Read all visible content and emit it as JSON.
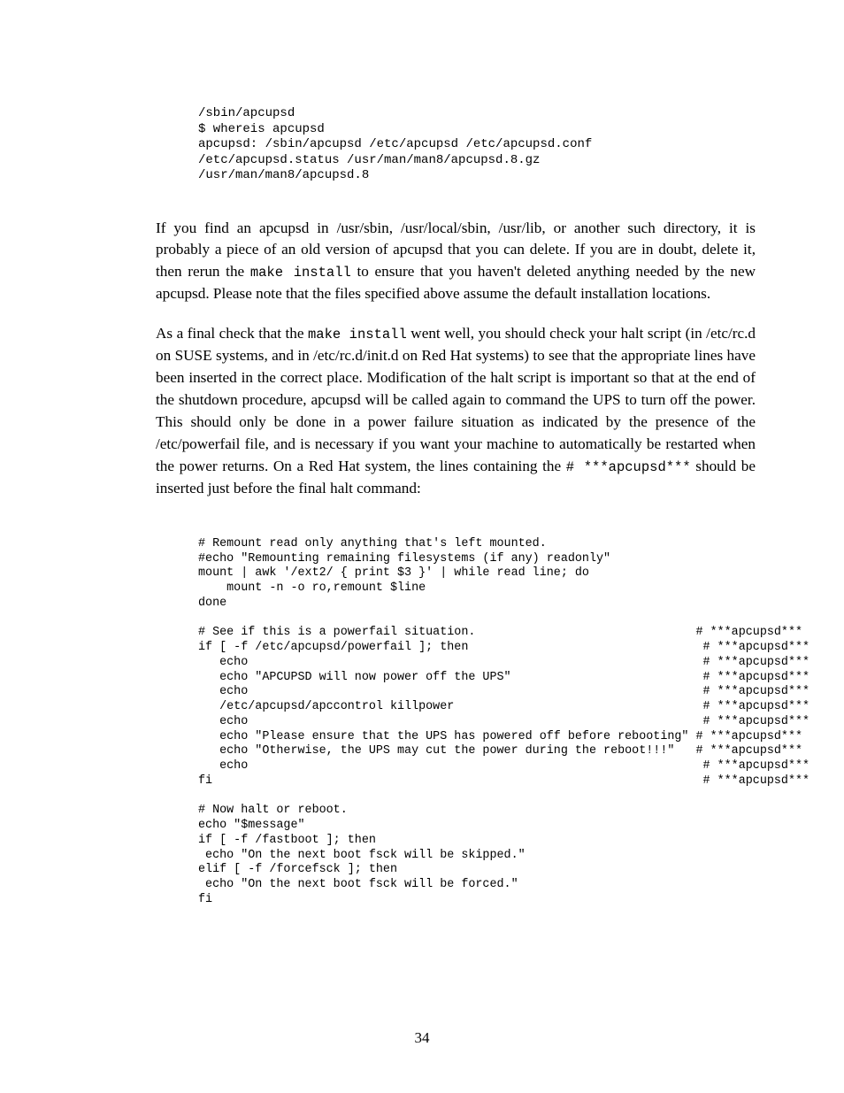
{
  "code1": "/sbin/apcupsd\n$ whereis apcupsd\napcupsd: /sbin/apcupsd /etc/apcupsd /etc/apcupsd.conf\n/etc/apcupsd.status /usr/man/man8/apcupsd.8.gz\n/usr/man/man8/apcupsd.8",
  "para1_a": "If you find an apcupsd in /usr/sbin, /usr/local/sbin, /usr/lib, or another such directory, it is probably a piece of an old version of apcupsd that you can delete. If you are in doubt, delete it, then rerun the ",
  "para1_code": "make install",
  "para1_b": " to ensure that you haven't deleted anything needed by the new apcupsd. Please note that the files specified above assume the default installation locations.",
  "para2_a": "As a final check that the ",
  "para2_code1": "make install",
  "para2_b": " went well, you should check your halt script (in /etc/rc.d on SUSE systems, and in /etc/rc.d/init.d on Red Hat systems) to see that the appropriate lines have been inserted in the correct place. Modification of the halt script is important so that at the end of the shutdown procedure, apcupsd will be called again to command the UPS to turn off the power. This should only be done in a power failure situation as indicated by the presence of the /etc/powerfail file, and is necessary if you want your machine to automatically be restarted when the power returns. On a Red Hat system, the lines containing the ",
  "para2_code2": "# ***apcupsd***",
  "para2_c": " should be inserted just before the final halt command:",
  "code2": "# Remount read only anything that's left mounted.\n#echo \"Remounting remaining filesystems (if any) readonly\"\nmount | awk '/ext2/ { print $3 }' | while read line; do\n    mount -n -o ro,remount $line\ndone\n\n# See if this is a powerfail situation.                               # ***apcupsd***\nif [ -f /etc/apcupsd/powerfail ]; then                                 # ***apcupsd***\n   echo                                                                # ***apcupsd***\n   echo \"APCUPSD will now power off the UPS\"                           # ***apcupsd***\n   echo                                                                # ***apcupsd***\n   /etc/apcupsd/apccontrol killpower                                   # ***apcupsd***\n   echo                                                                # ***apcupsd***\n   echo \"Please ensure that the UPS has powered off before rebooting\" # ***apcupsd***\n   echo \"Otherwise, the UPS may cut the power during the reboot!!!\"   # ***apcupsd***\n   echo                                                                # ***apcupsd***\nfi                                                                     # ***apcupsd***\n\n# Now halt or reboot.\necho \"$message\"\nif [ -f /fastboot ]; then\n echo \"On the next boot fsck will be skipped.\"\nelif [ -f /forcefsck ]; then\n echo \"On the next boot fsck will be forced.\"\nfi",
  "pagenum": "34"
}
